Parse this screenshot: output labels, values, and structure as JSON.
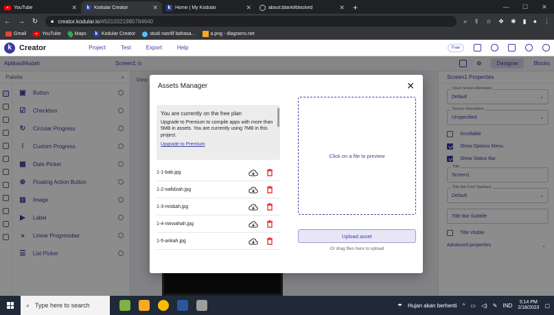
{
  "browser": {
    "tabs": [
      {
        "title": "YouTube",
        "favicon": "youtube-icon",
        "active": false
      },
      {
        "title": "Kodular Creator",
        "favicon": "kodular-icon",
        "active": true
      },
      {
        "title": "Home | My Kodular",
        "favicon": "kodular-icon",
        "active": false
      },
      {
        "title": "about:blank#blocked",
        "favicon": "globe-icon",
        "active": false
      }
    ],
    "url_host": "creator.kodular.io",
    "url_path": "/#5010321980784640",
    "bookmarks": [
      "Gmail",
      "YouTube",
      "Maps",
      "Kodular Creator",
      "studi nasrlif bahasa...",
      "a.png - diagrams.net"
    ]
  },
  "app": {
    "name": "Creator",
    "menu": [
      "Project",
      "Test",
      "Export",
      "Help"
    ],
    "free_badge": "Free",
    "project_name": "AplikasiMudah",
    "screen": "Screen1",
    "designer_label": "Designer",
    "blocks_label": "Blocks"
  },
  "palette": {
    "title": "Palette",
    "items": [
      {
        "label": "Button",
        "icon": "button-icon"
      },
      {
        "label": "Checkbox",
        "icon": "checkbox-icon"
      },
      {
        "label": "Circular Progress",
        "icon": "circular-progress-icon"
      },
      {
        "label": "Custom Progress",
        "icon": "custom-progress-icon"
      },
      {
        "label": "Date Picker",
        "icon": "date-picker-icon"
      },
      {
        "label": "Floating Action Button",
        "icon": "fab-icon"
      },
      {
        "label": "Image",
        "icon": "image-icon"
      },
      {
        "label": "Label",
        "icon": "label-icon"
      },
      {
        "label": "Linear Progressbar",
        "icon": "linear-progress-icon"
      },
      {
        "label": "List Picker",
        "icon": "list-picker-icon"
      }
    ]
  },
  "viewer": {
    "tab": "View"
  },
  "properties": {
    "title": "Screen1 Properties",
    "open_anim_legend": "Open Screen Animation",
    "open_anim_value": "Default",
    "orientation_legend": "Screen Orientation",
    "orientation_value": "Unspecified",
    "scrollable": "Scrollable",
    "show_options": "Show Options Menu",
    "show_status": "Show Status Bar",
    "title_legend": "Title",
    "title_value": "Screen1",
    "typeface_legend": "Title Bar Font Typeface",
    "typeface_value": "Default",
    "subtitle": "Title Bar Subtitle",
    "title_visible": "Title Visible",
    "advanced": "Advanced properties"
  },
  "modal": {
    "title": "Assets Manager",
    "notice_big": "You are currently on the free plan",
    "notice_body": "Upgrade to Premium to compile apps with more than 5MB in assets. You are currently using 7MB in this project.",
    "upgrade_link": "Upgrade to Premium",
    "assets": [
      "1-1-bab.jpg",
      "1-2-nafidzah.jpg",
      "1-3-misbah.jpg",
      "1-4-mirwahah.jpg",
      "1-5-arikah.jpg"
    ],
    "preview_text": "Click on a file to preview",
    "upload_label": "Upload asset",
    "drag_hint": "Or drag files here to upload"
  },
  "taskbar": {
    "search_placeholder": "Type here to search",
    "weather": "Hujan akan berhenti",
    "lang": "IND",
    "time": "5:14 PM",
    "date": "2/18/2023"
  },
  "colors": {
    "accent": "#3d3ba0",
    "danger": "#e53935"
  }
}
